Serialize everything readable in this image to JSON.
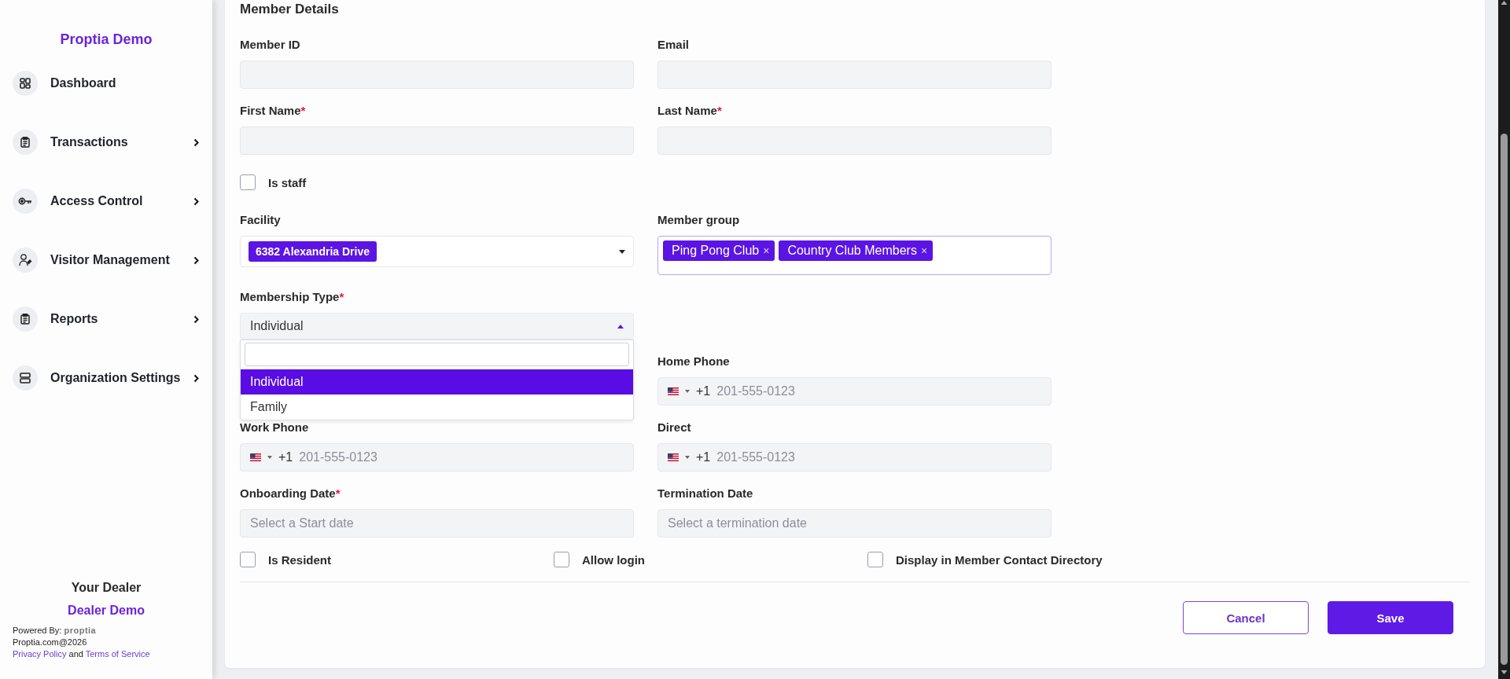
{
  "sidebar": {
    "brand": "Proptia Demo",
    "items": [
      {
        "label": "Dashboard",
        "has_children": false
      },
      {
        "label": "Transactions",
        "has_children": true
      },
      {
        "label": "Access Control",
        "has_children": true
      },
      {
        "label": "Visitor Management",
        "has_children": true
      },
      {
        "label": "Reports",
        "has_children": true
      },
      {
        "label": "Organization Settings",
        "has_children": true
      }
    ],
    "footer": {
      "dealer_heading": "Your Dealer",
      "dealer_name": "Dealer Demo",
      "powered_by": "Powered By:",
      "powered_logo": "proptia",
      "copyright": "Proptia.com@2026",
      "privacy_link": "Privacy Policy",
      "joiner": "and",
      "terms_link": "Terms of Service"
    }
  },
  "form": {
    "title": "Member Details",
    "rows": [
      {
        "left": {
          "kind": "text",
          "label": "Member ID"
        },
        "right": {
          "kind": "text",
          "label": "Email"
        }
      },
      {
        "left": {
          "kind": "text",
          "label": "First Name",
          "required_mark": "*"
        },
        "right": {
          "kind": "text",
          "label": "Last Name",
          "required_mark": "*"
        }
      },
      {
        "left": {
          "kind": "checkbox",
          "label": "Is staff",
          "checked": false
        }
      },
      {
        "left": {
          "kind": "select",
          "label": "Facility",
          "chips": [
            {
              "label": "6382 Alexandria Drive"
            }
          ]
        },
        "right": {
          "kind": "tags",
          "label": "Member group",
          "focused": true,
          "chips": [
            {
              "label": "Ping Pong Club",
              "remove": "×"
            },
            {
              "label": "Country Club Members",
              "remove": "×"
            }
          ]
        }
      },
      {
        "left": {
          "kind": "dropdown",
          "label": "Membership Type",
          "required_mark": "*",
          "value": "Individual",
          "expanded": true,
          "options": [
            {
              "label": "Individual",
              "selected": true
            },
            {
              "label": "Family",
              "selected": false
            }
          ]
        }
      },
      {
        "right": {
          "kind": "phone",
          "label": "Home Phone",
          "code": "+1",
          "placeholder": "201-555-0123"
        }
      },
      {
        "left": {
          "kind": "phone",
          "label": "Work Phone",
          "code": "+1",
          "placeholder": "201-555-0123"
        },
        "right": {
          "kind": "phone",
          "label": "Direct",
          "code": "+1",
          "placeholder": "201-555-0123"
        }
      },
      {
        "left": {
          "kind": "date",
          "label": "Onboarding Date",
          "required_mark": "*",
          "placeholder": "Select a Start date"
        },
        "right": {
          "kind": "date",
          "label": "Termination Date",
          "placeholder": "Select a termination date"
        }
      }
    ],
    "options": [
      {
        "label": "Is Resident",
        "checked": false
      },
      {
        "label": "Allow login",
        "checked": false
      },
      {
        "label": "Display in Member Contact Directory",
        "checked": false
      }
    ],
    "buttons": [
      {
        "label": "Cancel",
        "kind": "secondary"
      },
      {
        "label": "Save",
        "kind": "primary"
      }
    ]
  }
}
